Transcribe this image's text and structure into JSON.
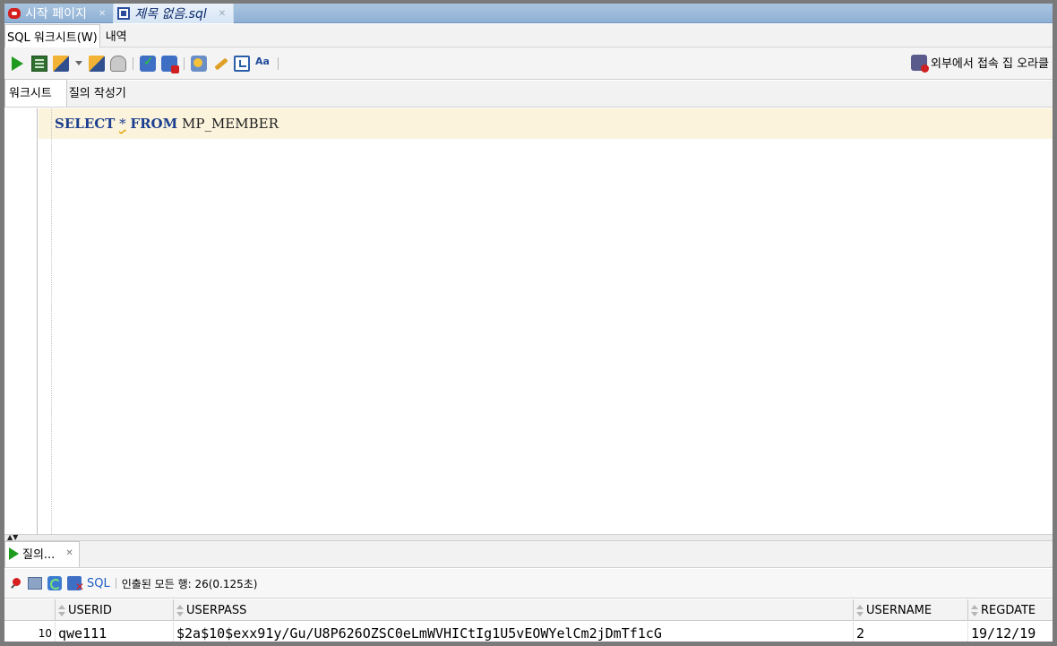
{
  "doc_tabs": [
    {
      "label": "시작 페이지",
      "icon": "oracle-icon",
      "active": false
    },
    {
      "label": "제목 없음.sql",
      "icon": "sql-file-icon",
      "active": true
    }
  ],
  "sub_tabs": {
    "worksheet": "SQL 워크시트(W)",
    "history": "내역"
  },
  "toolbar": {
    "icons": [
      "run-statement-icon",
      "run-script-icon",
      "autotrace-icon",
      "explain-plan-icon",
      "sql-tuning-icon",
      "commit-icon",
      "rollback-icon",
      "unshared-sql-icon",
      "clear-icon",
      "history-icon",
      "format-icon"
    ],
    "external_connect_label": "외부에서 접속 집 오라클"
  },
  "worksheet_tabs": {
    "worksheet": "워크시트",
    "query_builder": "질의 작성기"
  },
  "editor": {
    "keyword_select": "SELECT",
    "star": "*",
    "keyword_from": "FROM",
    "table": "MP_MEMBER"
  },
  "results": {
    "tab_label": "질의...",
    "sql_link": "SQL",
    "status": "인출된 모든 행: 26(0.125초)",
    "columns": [
      "USERID",
      "USERPASS",
      "USERNAME",
      "REGDATE"
    ],
    "rows": [
      {
        "rownum": "10",
        "USERID": "qwe111",
        "USERPASS": "$2a$10$exx91y/Gu/U8P626OZSC0eLmWVHICtIg1U5vEOWYelCm2jDmTf1cG",
        "USERNAME": "2",
        "REGDATE": "19/12/19"
      }
    ]
  },
  "colors": {
    "keyword": "#1c3f8f",
    "current_line": "#fbf3dc",
    "tab_bar": "#8fb0d4"
  }
}
